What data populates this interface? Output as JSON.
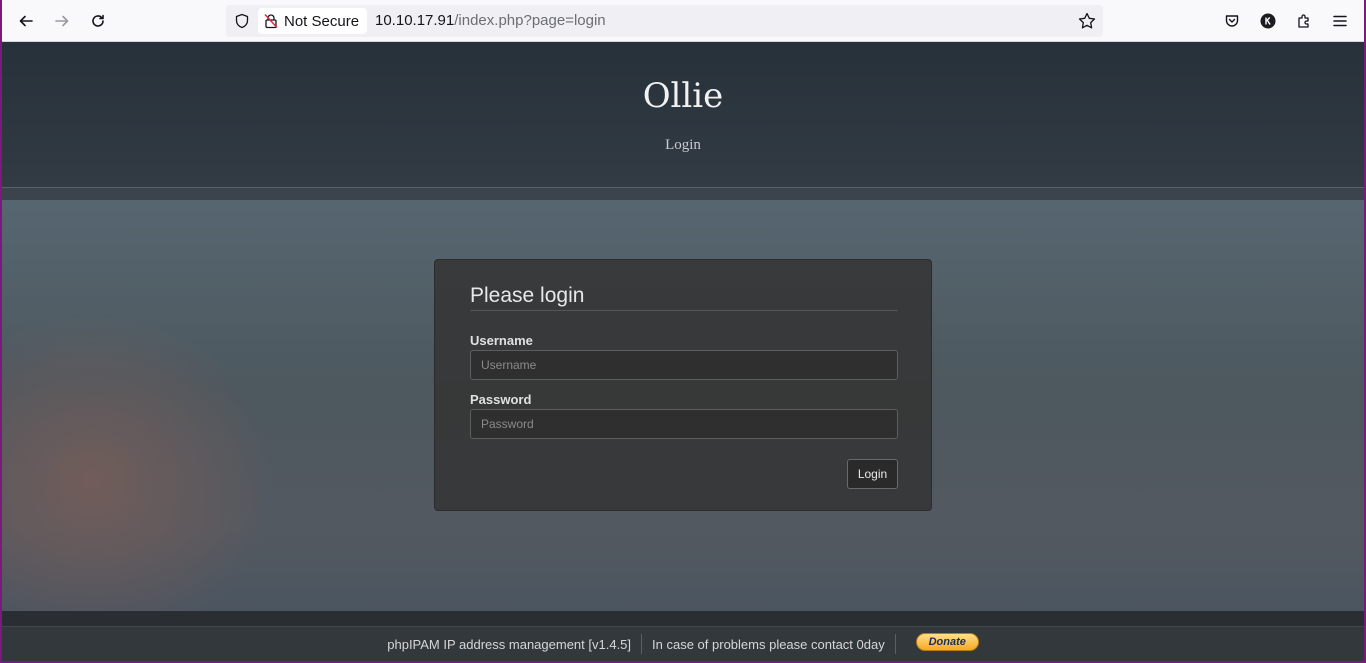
{
  "browser": {
    "security_label": "Not Secure",
    "url_host": "10.10.17.91",
    "url_path": "/index.php?page=login"
  },
  "header": {
    "site_title": "Ollie",
    "subtitle": "Login"
  },
  "login": {
    "title": "Please login",
    "username_label": "Username",
    "username_placeholder": "Username",
    "password_label": "Password",
    "password_placeholder": "Password",
    "submit_label": "Login"
  },
  "footer": {
    "app_text": "phpIPAM IP address management [v1.4.5]",
    "contact_text": "In case of problems please contact 0day",
    "donate_label": "Donate"
  }
}
